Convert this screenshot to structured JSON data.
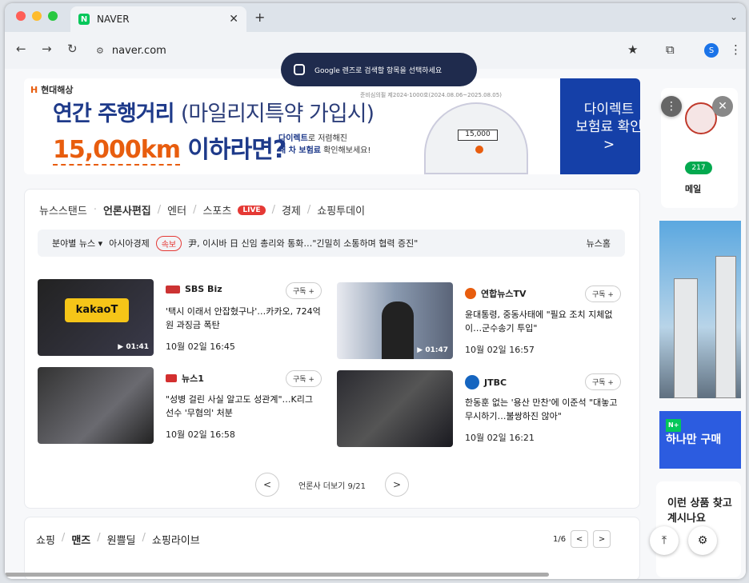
{
  "browser": {
    "tab_title": "NAVER",
    "tab_favicon": "N",
    "address": "naver.com",
    "profile_initial": "S",
    "lens_prompt": "Google 렌즈로 검색할 항목을 선택하세요"
  },
  "ad": {
    "brand": "현대해상",
    "disclaimer": "준비심의필 제2024-1000호(2024.08.06~2025.08.05)",
    "line1_bold": "연간 주행거리",
    "line1_light": "(마일리지특약 가입시)",
    "line2_km": "15,000km",
    "line2_rest": " 이하라면?",
    "sub1_bold": "다이렉트",
    "sub1_rest": "로 저렴해진",
    "sub2_bold": "내 차 보험료",
    "sub2_rest": " 확인해보세요!",
    "odometer": "15,000",
    "button_line1": "다이렉트",
    "button_line2": "보험료 확인",
    "button_arrow": ">"
  },
  "news": {
    "tabs": [
      "뉴스스탠드",
      "언론사편집",
      "엔터",
      "스포츠",
      "경제",
      "쇼핑투데이"
    ],
    "live_label": "LIVE",
    "ticker": {
      "category": "분야별 뉴스 ▾",
      "source": "아시아경제",
      "badge": "속보",
      "headline": "尹, 이시바 日 신임 총리와 통화…\"긴밀히 소통하며 협력 증진\"",
      "home": "뉴스홈"
    },
    "cards": [
      {
        "publisher": "SBS Biz",
        "subscribe": "구독 +",
        "headline": "'택시 이래서 안잡혔구나'…카카오, 724억원 과징금 폭탄",
        "time": "10월 02일 16:45",
        "duration": "01:41",
        "thumb_text": "kakaoT"
      },
      {
        "publisher": "연합뉴스TV",
        "subscribe": "구독 +",
        "headline": "윤대통령, 중동사태에 \"필요 조치 지체없이…군수송기 투입\"",
        "time": "10월 02일 16:57",
        "duration": "01:47"
      },
      {
        "publisher": "뉴스1",
        "subscribe": "구독 +",
        "headline": "\"성병 걸린 사실 알고도 성관계\"…K리그 선수 '무혐의' 처분",
        "time": "10월 02일 16:58"
      },
      {
        "publisher": "JTBC",
        "subscribe": "구독 +",
        "headline": "한동훈 없는 '용산 만찬'에 이준석 \"대놓고 무시하기…불쌍하진 않아\"",
        "time": "10월 02일 16:21"
      }
    ],
    "pager_label": "언론사 더보기 9/21",
    "prev": "<",
    "next": ">"
  },
  "shopping": {
    "tabs": [
      "쇼핑",
      "맨즈",
      "원쁠딜",
      "쇼핑라이브"
    ],
    "page": "1/6",
    "prev": "<",
    "next": ">"
  },
  "sidebar": {
    "mail_count": "217",
    "mail_label": "메일",
    "ad2_line1": "하나만 구매",
    "ad2_tag": "N+",
    "side3_text": "이런 상품 찾고 계시나요"
  },
  "colors": {
    "naver_green": "#03c75a",
    "hyundai_navy": "#1e3a8a",
    "hyundai_orange": "#e85d0e",
    "live_red": "#e53935"
  }
}
